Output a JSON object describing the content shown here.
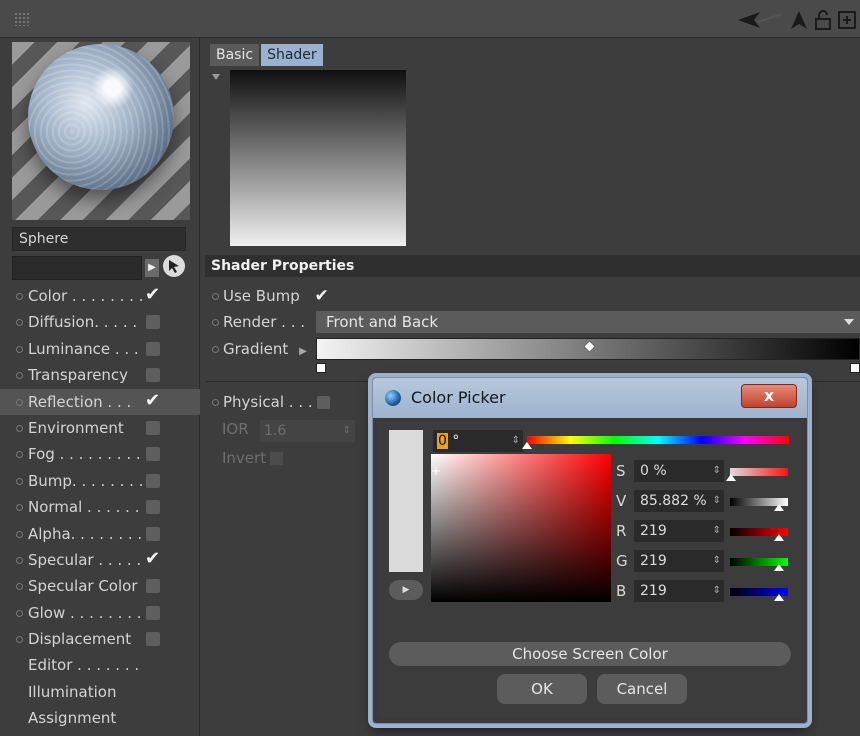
{
  "titlebar": {
    "icons": [
      "grip-icon",
      "back-arrow-icon",
      "up-arrow-icon",
      "lock-icon",
      "new-window-icon"
    ]
  },
  "left": {
    "object_name": "Sphere",
    "channels": [
      {
        "label": "Color . . . . . . . .",
        "checked": true
      },
      {
        "label": "Diffusion. . . . .",
        "checked": false
      },
      {
        "label": "Luminance . . .",
        "checked": false
      },
      {
        "label": "Transparency",
        "checked": false
      },
      {
        "label": "Reflection . . .",
        "checked": true
      },
      {
        "label": "Environment",
        "checked": false
      },
      {
        "label": "Fog . . . . . . . . .",
        "checked": false
      },
      {
        "label": "Bump. . . . . . . .",
        "checked": false
      },
      {
        "label": "Normal . . . . . .",
        "checked": false
      },
      {
        "label": "Alpha. . . . . . . .",
        "checked": false
      },
      {
        "label": "Specular . . . . .",
        "checked": true
      },
      {
        "label": "Specular Color",
        "checked": false
      },
      {
        "label": "Glow . . . . . . . .",
        "checked": false
      },
      {
        "label": "Displacement",
        "checked": false
      }
    ],
    "extra": [
      "Editor . . . . . . .",
      "Illumination",
      "Assignment"
    ]
  },
  "right": {
    "tabs": [
      "Basic",
      "Shader"
    ],
    "section_title": "Shader Properties",
    "use_bump_label": "Use Bump",
    "render_label": "Render . . .",
    "render_value": "Front and Back",
    "gradient_label": "Gradient",
    "physical_label": "Physical . . .",
    "ior_label": "IOR",
    "ior_value": "1.6",
    "invert_label": "Invert"
  },
  "color_picker": {
    "title": "Color Picker",
    "close_label": "x",
    "hue_value": "0",
    "hue_unit": " °",
    "channels": [
      {
        "label": "S",
        "value": "0 %"
      },
      {
        "label": "V",
        "value": "85.882 %"
      },
      {
        "label": "R",
        "value": "219"
      },
      {
        "label": "G",
        "value": "219"
      },
      {
        "label": "B",
        "value": "219"
      }
    ],
    "choose_screen_label": "Choose Screen Color",
    "ok_label": "OK",
    "cancel_label": "Cancel",
    "colors": {
      "current": "#dbdbdb",
      "title_bar": "#a9bdd6",
      "close_button": "#d0563f"
    }
  }
}
